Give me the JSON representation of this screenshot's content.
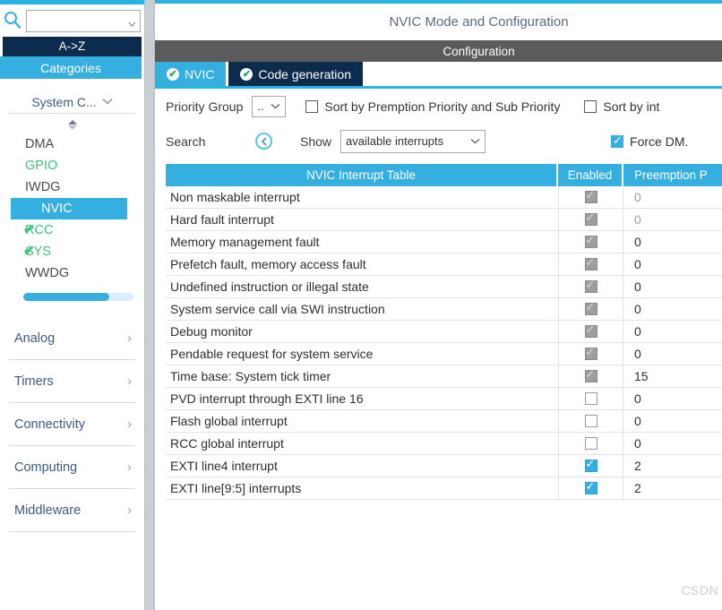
{
  "sidebar": {
    "search": {
      "value": "",
      "placeholder": "",
      "icon": "search-icon"
    },
    "view_buttons": {
      "az_label": "A->Z",
      "categories_label": "Categories"
    },
    "group": {
      "label": "System C...",
      "chevron": "chevron-down-icon"
    },
    "peripherals": [
      {
        "label": "DMA",
        "state": "plain",
        "checked": false
      },
      {
        "label": "GPIO",
        "state": "green",
        "checked": false
      },
      {
        "label": "IWDG",
        "state": "plain",
        "checked": false
      },
      {
        "label": "NVIC",
        "state": "selected",
        "checked": false
      },
      {
        "label": "RCC",
        "state": "green",
        "checked": true
      },
      {
        "label": "SYS",
        "state": "green",
        "checked": true
      },
      {
        "label": "WWDG",
        "state": "plain",
        "checked": false
      }
    ],
    "categories": [
      {
        "label": "Analog"
      },
      {
        "label": "Timers"
      },
      {
        "label": "Connectivity"
      },
      {
        "label": "Computing"
      },
      {
        "label": "Middleware"
      }
    ],
    "scroll_percent": 78
  },
  "main": {
    "title": "NVIC Mode and Configuration",
    "config_bar": "Configuration",
    "tabs": [
      {
        "label": "NVIC",
        "active": true
      },
      {
        "label": "Code generation",
        "active": false
      }
    ],
    "options": {
      "priority_group_label": "Priority Group",
      "priority_group_value": "..",
      "sort_premption_label": "Sort by Premption Priority and Sub Priority",
      "sort_premption_checked": false,
      "sort_interrupt_label": "Sort by int",
      "sort_interrupt_checked": false,
      "search_label": "Search",
      "search_nav_icon": "chevron-left-circle-icon",
      "show_label": "Show",
      "show_value": "available interrupts",
      "force_dma_label": "Force DM.",
      "force_dma_checked": true
    },
    "table": {
      "columns": [
        "NVIC Interrupt Table",
        "Enabled",
        "Preemption P"
      ],
      "rows": [
        {
          "name": "Non maskable interrupt",
          "enabled": "locked",
          "priority": "0",
          "dim": true
        },
        {
          "name": "Hard fault interrupt",
          "enabled": "locked",
          "priority": "0",
          "dim": true
        },
        {
          "name": "Memory management fault",
          "enabled": "locked",
          "priority": "0",
          "dim": false
        },
        {
          "name": "Prefetch fault, memory access fault",
          "enabled": "locked",
          "priority": "0",
          "dim": false
        },
        {
          "name": "Undefined instruction or illegal state",
          "enabled": "locked",
          "priority": "0",
          "dim": false
        },
        {
          "name": "System service call via SWI instruction",
          "enabled": "locked",
          "priority": "0",
          "dim": false
        },
        {
          "name": "Debug monitor",
          "enabled": "locked",
          "priority": "0",
          "dim": false
        },
        {
          "name": "Pendable request for system service",
          "enabled": "locked",
          "priority": "0",
          "dim": false
        },
        {
          "name": "Time base: System tick timer",
          "enabled": "locked",
          "priority": "15",
          "dim": false
        },
        {
          "name": "PVD interrupt through EXTI line 16",
          "enabled": "off",
          "priority": "0",
          "dim": false
        },
        {
          "name": "Flash global interrupt",
          "enabled": "off",
          "priority": "0",
          "dim": false
        },
        {
          "name": "RCC global interrupt",
          "enabled": "off",
          "priority": "0",
          "dim": false
        },
        {
          "name": "EXTI line4 interrupt",
          "enabled": "on",
          "priority": "2",
          "dim": false
        },
        {
          "name": "EXTI line[9:5] interrupts",
          "enabled": "on",
          "priority": "2",
          "dim": false
        }
      ]
    },
    "watermark": "CSDN @恐。 。 。"
  },
  "colors": {
    "accent": "#35aee0",
    "dark_navy": "#0d2b4d",
    "gray_bar": "#5b5b5b",
    "green": "#3fbf7f",
    "label_blue": "#3e5a84"
  }
}
